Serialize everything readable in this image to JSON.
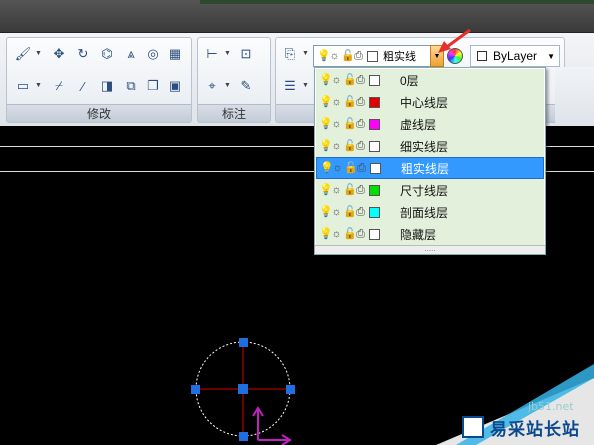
{
  "ribbon": {
    "panels": [
      {
        "title": "修改"
      },
      {
        "title": "标注"
      },
      {
        "title": ""
      }
    ]
  },
  "layer_combo": {
    "current": "粗实线",
    "color_name": "ByLayer"
  },
  "layers": [
    {
      "name": "0层",
      "color": "#ffffff",
      "selected": false
    },
    {
      "name": "中心线层",
      "color": "#e00000",
      "selected": false
    },
    {
      "name": "虚线层",
      "color": "#ff00ff",
      "selected": false
    },
    {
      "name": "细实线层",
      "color": "#ffffff",
      "selected": false
    },
    {
      "name": "粗实线层",
      "color": "#ffffff",
      "selected": true
    },
    {
      "name": "尺寸线层",
      "color": "#00e000",
      "selected": false
    },
    {
      "name": "剖面线层",
      "color": "#00ffff",
      "selected": false
    },
    {
      "name": "隐藏层",
      "color": "#ffffff",
      "selected": false
    }
  ],
  "watermark": {
    "text": "易采站长站",
    "url": "jb51.net"
  },
  "colors": {
    "selection": "#3399ff",
    "list_bg": "#e2f0dc",
    "grip": "#1e6fe0"
  }
}
